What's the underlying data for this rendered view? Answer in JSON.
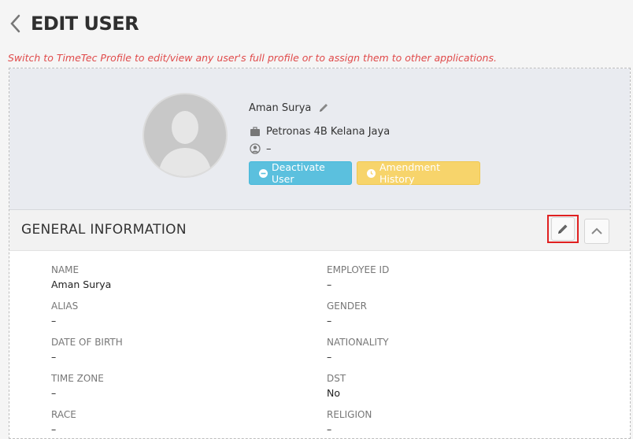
{
  "page": {
    "title": "EDIT USER",
    "notice": "Switch to TimeTec Profile to edit/view any user's full profile or to assign them to other applications."
  },
  "profile": {
    "name": "Aman Surya",
    "company": "Petronas 4B Kelana Jaya",
    "role": "–",
    "deactivate_label": "Deactivate User",
    "history_label": "Amendment History",
    "colors": {
      "deactivate": "#5bc0de",
      "history": "#f7d46b"
    }
  },
  "general": {
    "title": "GENERAL INFORMATION",
    "fields": [
      {
        "label": "NAME",
        "value": "Aman Surya"
      },
      {
        "label": "EMPLOYEE ID",
        "value": "–"
      },
      {
        "label": "ALIAS",
        "value": "–"
      },
      {
        "label": "GENDER",
        "value": "–"
      },
      {
        "label": "DATE OF BIRTH",
        "value": "–"
      },
      {
        "label": "NATIONALITY",
        "value": "–"
      },
      {
        "label": "TIME ZONE",
        "value": "–"
      },
      {
        "label": "DST",
        "value": "No"
      },
      {
        "label": "RACE",
        "value": "–"
      },
      {
        "label": "RELIGION",
        "value": "–"
      }
    ]
  },
  "icons": {
    "back": "chevron-left-icon",
    "edit_name": "pencil-icon",
    "company": "briefcase-icon",
    "role": "user-circle-icon",
    "deactivate": "minus-circle-icon",
    "history": "clock-icon",
    "edit_section": "pencil-icon",
    "collapse": "chevron-up-icon"
  }
}
